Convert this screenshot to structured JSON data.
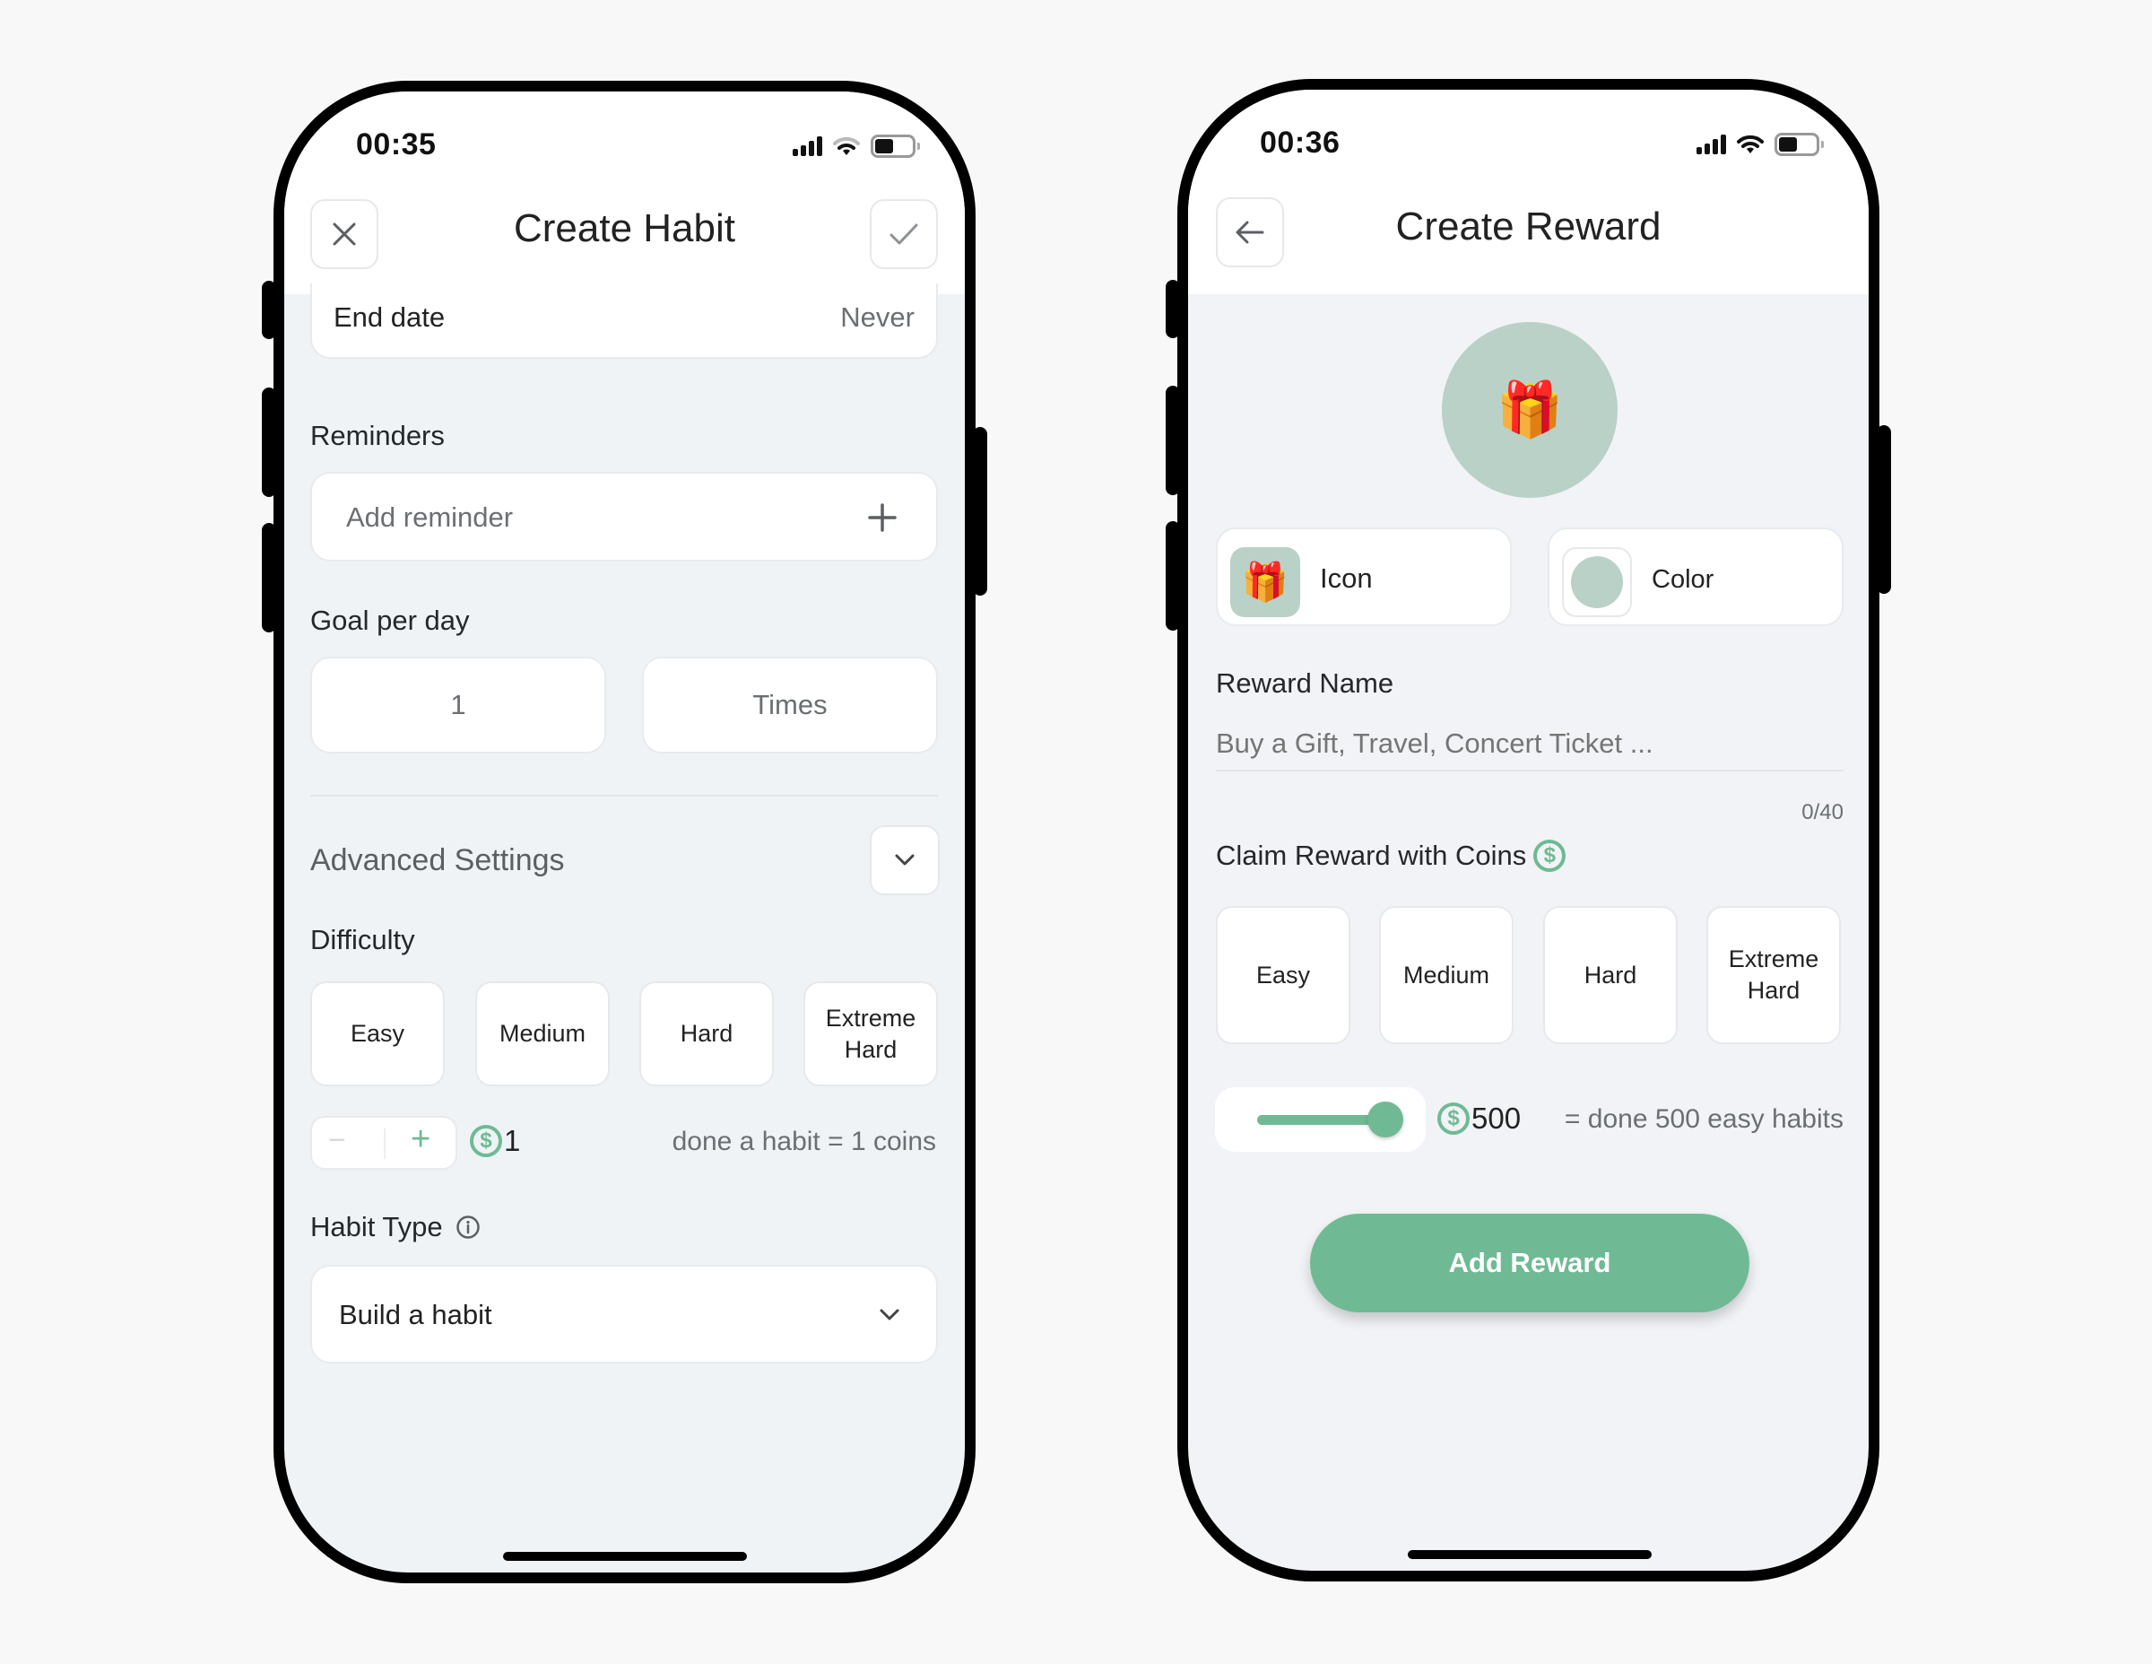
{
  "left_phone": {
    "status": {
      "time": "00:35",
      "battery_percent": 40,
      "wifi_bars": 2,
      "signal_bars": 4
    },
    "header": {
      "title": "Create Habit",
      "close_icon": "close-icon",
      "confirm_icon": "checkmark-icon"
    },
    "end_date": {
      "label": "End date",
      "value": "Never"
    },
    "reminders": {
      "label": "Reminders",
      "placeholder": "Add reminder",
      "add_icon": "plus-icon"
    },
    "goal": {
      "label": "Goal per day",
      "amount": "1",
      "unit": "Times"
    },
    "advanced": {
      "label": "Advanced Settings",
      "toggle_icon": "chevron-down-icon"
    },
    "difficulty": {
      "label": "Difficulty",
      "options": [
        "Easy",
        "Medium",
        "Hard",
        "Extreme Hard"
      ]
    },
    "coins": {
      "minus": "−",
      "plus": "+",
      "coin_symbol": "$",
      "value": "1",
      "description": "done a habit = 1 coins"
    },
    "habit_type": {
      "label": "Habit Type",
      "info_icon": "info-icon",
      "selected": "Build a habit"
    }
  },
  "right_phone": {
    "status": {
      "time": "00:36",
      "battery_percent": 40,
      "wifi_bars": 3,
      "signal_bars": 4
    },
    "header": {
      "title": "Create Reward",
      "back_icon": "arrow-left-icon"
    },
    "preview": {
      "icon": "🎁",
      "color": "#b9d1c7"
    },
    "icon_picker": {
      "label": "Icon",
      "icon": "🎁"
    },
    "color_picker": {
      "label": "Color",
      "color": "#b9d1c7"
    },
    "reward_name": {
      "label": "Reward Name",
      "placeholder": "Buy a Gift, Travel, Concert Ticket ...",
      "value": "",
      "counter": "0/40"
    },
    "claim": {
      "label": "Claim Reward with Coins",
      "options": [
        "Easy",
        "Medium",
        "Hard",
        "Extreme Hard"
      ]
    },
    "coin_slider": {
      "value": "500",
      "fraction": 1.0,
      "coin_symbol": "$",
      "description": "= done 500 easy habits"
    },
    "submit": {
      "label": "Add Reward"
    }
  },
  "colors": {
    "accent": "#6fba94",
    "background": "#eff3f6",
    "card": "#ffffff",
    "preview": "#b9d1c7"
  }
}
